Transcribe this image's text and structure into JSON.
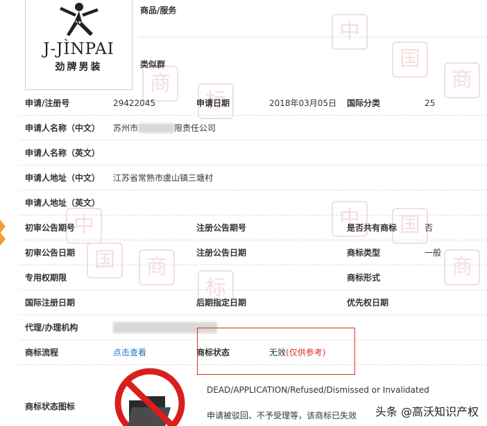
{
  "logo": {
    "brand": "J-JÌNPAI",
    "subtitle": "劲牌男装"
  },
  "header": {
    "goods_label": "商品/服务",
    "similar_label": "类似群"
  },
  "rows": {
    "app_no_label": "申请/注册号",
    "app_no": "29422045",
    "app_date_label": "申请日期",
    "app_date": "2018年03月05日",
    "intl_class_label": "国际分类",
    "intl_class": "25",
    "applicant_cn_label": "申请人名称（中文）",
    "applicant_cn_prefix": "苏州市",
    "applicant_cn_suffix": "限责任公司",
    "applicant_en_label": "申请人名称（英文）",
    "address_cn_label": "申请人地址（中文）",
    "address_cn": "江苏省常熟市虞山镇三塘村",
    "address_en_label": "申请人地址（英文）",
    "prelim_pub_no_label": "初审公告期号",
    "reg_pub_no_label": "注册公告期号",
    "shared_label": "是否共有商标",
    "shared": "否",
    "prelim_pub_date_label": "初审公告日期",
    "reg_pub_date_label": "注册公告日期",
    "tm_type_label": "商标类型",
    "tm_type": "一般",
    "exclusive_label": "专用权期限",
    "tm_form_label": "商标形式",
    "intl_reg_date_label": "国际注册日期",
    "later_date_label": "后期指定日期",
    "priority_date_label": "优先权日期",
    "agent_label": "代理/办理机构",
    "process_label": "商标流程",
    "process_link": "点击查看",
    "status_label": "商标状态",
    "status_value": "无效",
    "status_note": "(仅供参考)",
    "status_icon_label": "商标状态图标",
    "status_en": "DEAD/APPLICATION/Refused/Dismissed or Invalidated",
    "status_cn": "申请被驳回、不予受理等，该商标已失效"
  },
  "footer": {
    "watermark": "头条 @高沃知识产权"
  },
  "colors": {
    "accent_red": "#d93025",
    "link_blue": "#1a73c8"
  }
}
